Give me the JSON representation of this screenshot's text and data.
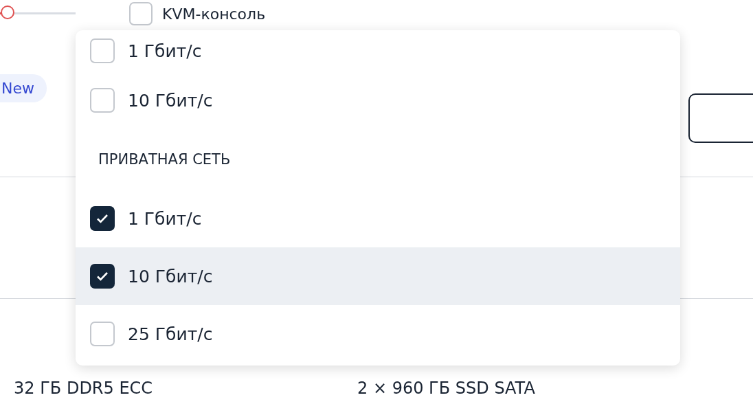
{
  "price_slider": {
    "level": 0.115
  },
  "kvm_checkbox": {
    "label": "KVM-консоль",
    "checked": false
  },
  "badge": "New",
  "bottom_specs": [
    "32 ГБ DDR5 ECC",
    "2 × 960 ГБ SSD SATA"
  ],
  "dropdown": {
    "items": [
      {
        "kind": "option",
        "label": "1 Гбит/с",
        "checked": false,
        "hovered": false
      },
      {
        "kind": "option",
        "label": "10 Гбит/с",
        "checked": false,
        "hovered": false
      },
      {
        "kind": "header",
        "label": "ПРИВАТНАЯ СЕТЬ"
      },
      {
        "kind": "option",
        "label": "1 Гбит/с",
        "checked": true,
        "hovered": false
      },
      {
        "kind": "option",
        "label": "10 Гбит/с",
        "checked": true,
        "hovered": true
      },
      {
        "kind": "option",
        "label": "25 Гбит/с",
        "checked": false,
        "hovered": false
      }
    ]
  }
}
